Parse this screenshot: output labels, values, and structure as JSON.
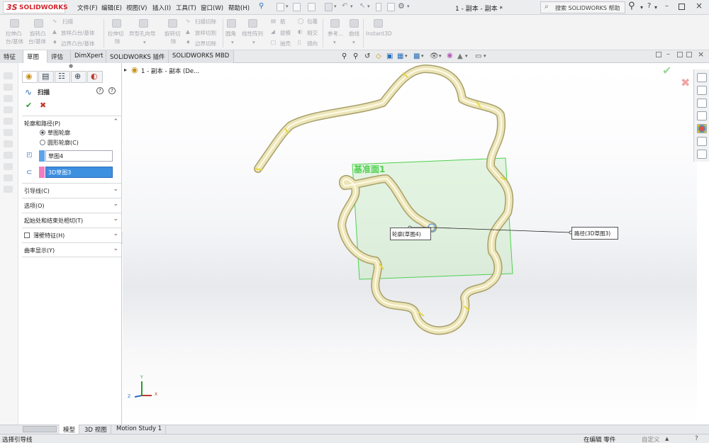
{
  "app": {
    "logo_prefix": "3S",
    "logo_name": "SOLIDWORKS",
    "document_title": "1 - 副本 - 副本 *"
  },
  "menu": [
    "文件(F)",
    "编辑(E)",
    "视图(V)",
    "插入(I)",
    "工具(T)",
    "窗口(W)",
    "帮助(H)"
  ],
  "search": {
    "placeholder": "搜索 SOLIDWORKS 帮助"
  },
  "command": {
    "items": [
      {
        "l1": "拉伸凸",
        "l2": "台/基体"
      },
      {
        "l1": "旋转凸",
        "l2": "台/基体"
      },
      {
        "l1": "扫描",
        "l2": ""
      },
      {
        "l1": "放样凸台/基体",
        "l2": ""
      },
      {
        "l1": "边界凸台/基体",
        "l2": ""
      },
      {
        "l1": "拉伸切",
        "l2": "除"
      },
      {
        "l1": "异型孔向导",
        "l2": ""
      },
      {
        "l1": "旋转切",
        "l2": "除"
      },
      {
        "l1": "扫描切除",
        "l2": ""
      },
      {
        "l1": "放样切割",
        "l2": ""
      },
      {
        "l1": "边界切除",
        "l2": ""
      },
      {
        "l1": "圆角",
        "l2": ""
      },
      {
        "l1": "线性阵列",
        "l2": ""
      },
      {
        "l1": "筋",
        "l2": ""
      },
      {
        "l1": "拔模",
        "l2": ""
      },
      {
        "l1": "抽壳",
        "l2": ""
      },
      {
        "l1": "包覆",
        "l2": ""
      },
      {
        "l1": "相交",
        "l2": ""
      },
      {
        "l1": "镜向",
        "l2": ""
      },
      {
        "l1": "参考...",
        "l2": ""
      },
      {
        "l1": "曲线",
        "l2": ""
      },
      {
        "l1": "Instant3D",
        "l2": ""
      }
    ]
  },
  "tabs": [
    "特征",
    "草图",
    "评估",
    "DimXpert",
    "SOLIDWORKS 插件",
    "SOLIDWORKS MBD"
  ],
  "feature_tree": {
    "root": "1 - 副本 - 副本  (De..."
  },
  "property_manager": {
    "title": "扫描",
    "section_profile": "轮廓和路径(P)",
    "radio_sketch": "草图轮廓",
    "radio_circle": "圆形轮廓(C)",
    "profile_value": "草图4",
    "path_value": "3D草图3",
    "sections": [
      "引导线(C)",
      "选项(O)",
      "起始处和结束处相切(T)",
      "薄壁特征(H)",
      "曲率显示(Y)"
    ]
  },
  "viewport": {
    "plane_label": "基准面1",
    "callout_profile": "轮廓(草图4)",
    "callout_path": "路径(3D草图3)",
    "triad": {
      "x": "X",
      "y": "Y",
      "z": "Z"
    }
  },
  "bottom_tabs": [
    "模型",
    "3D 视图",
    "Motion Study 1"
  ],
  "status": {
    "left": "选择引导线",
    "right1": "在编辑 零件",
    "right2": "自定义"
  },
  "colors": {
    "accent_blue": "#1e73c8",
    "tube": "#e9e3b6",
    "plane": "#4fd04f",
    "sweep_icon": "#2a6fb8"
  }
}
